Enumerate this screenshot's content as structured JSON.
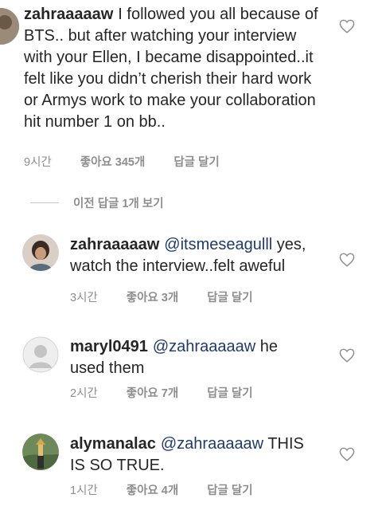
{
  "comments": [
    {
      "username": "zahraaaaaw",
      "text": "I followed you all because of BTS.. but after watching your interview with your Ellen, I became disappointed..it felt like you didn’t cherish their hard work or Armys work to make your collaboration hit number 1 on bb..",
      "time": "9시간",
      "likes": "좋아요 345개",
      "reply": "답글 달기"
    },
    {
      "username": "zahraaaaaw",
      "mention": "@itsmeseagulll",
      "text": " yes, watch the interview..felt aweful",
      "time": "3시간",
      "likes": "좋아요 3개",
      "reply": "답글 달기"
    },
    {
      "username": "maryl0491",
      "mention": "@zahraaaaaw",
      "text": " he used them",
      "time": "2시간",
      "likes": "좋아요 7개",
      "reply": "답글 달기"
    },
    {
      "username": "alymanalac",
      "mention": "@zahraaaaaw",
      "text": " THIS IS SO TRUE.",
      "time": "1시간",
      "likes": "좋아요 4개",
      "reply": "답글 달기"
    }
  ],
  "view_previous_replies": "이전 답글 1개 보기",
  "icons": {
    "like": "heart-outline-icon"
  },
  "colors": {
    "mention": "#1f3a6b",
    "meta": "#8e8e8e"
  }
}
